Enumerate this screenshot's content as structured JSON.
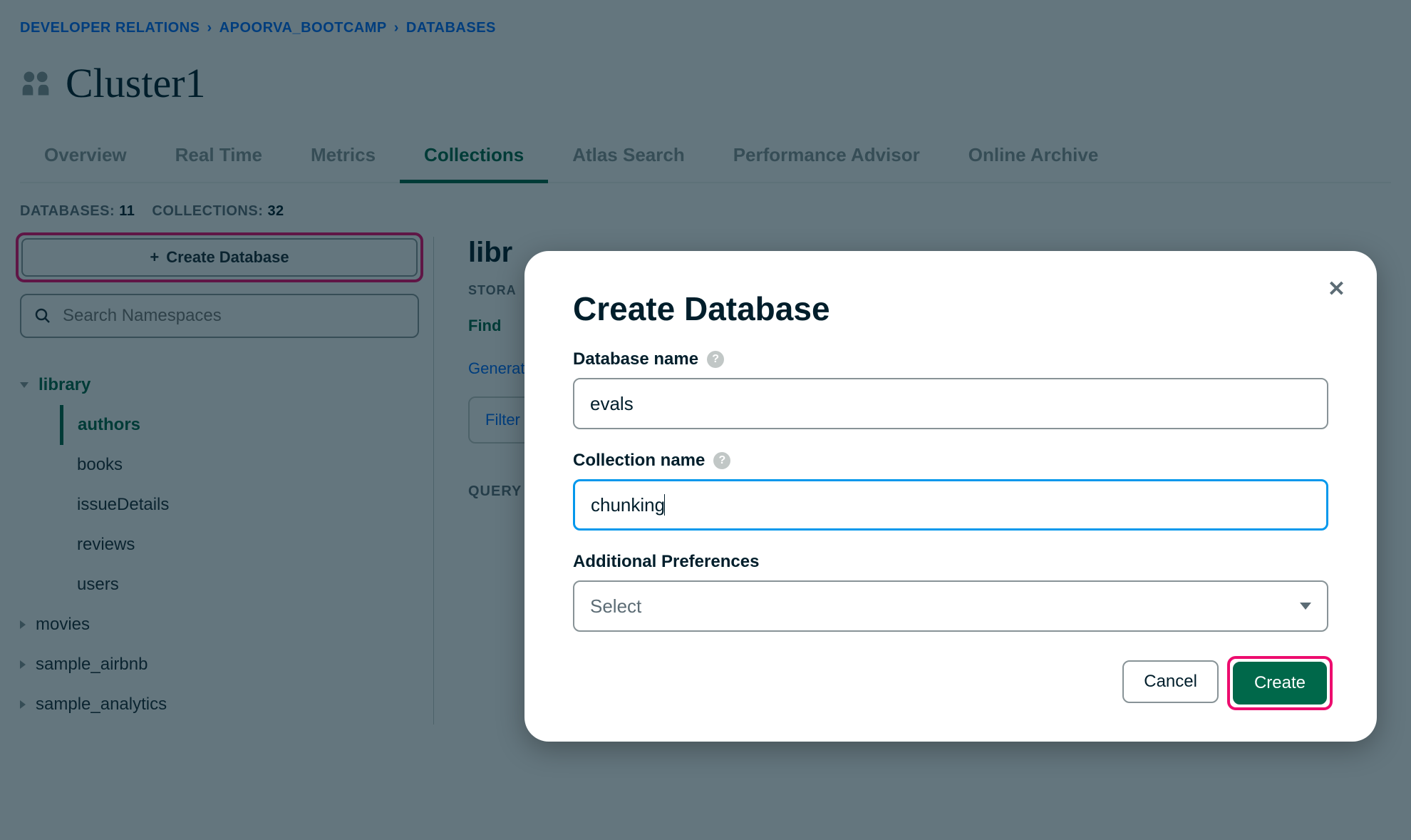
{
  "breadcrumb": [
    "DEVELOPER RELATIONS",
    "APOORVA_BOOTCAMP",
    "DATABASES"
  ],
  "cluster_name": "Cluster1",
  "tabs": [
    {
      "label": "Overview",
      "active": false
    },
    {
      "label": "Real Time",
      "active": false
    },
    {
      "label": "Metrics",
      "active": false
    },
    {
      "label": "Collections",
      "active": true
    },
    {
      "label": "Atlas Search",
      "active": false
    },
    {
      "label": "Performance Advisor",
      "active": false
    },
    {
      "label": "Online Archive",
      "active": false
    }
  ],
  "counts": {
    "db_label": "DATABASES:",
    "db_val": "11",
    "coll_label": "COLLECTIONS:",
    "coll_val": "32"
  },
  "create_db_label": "Create Database",
  "search_placeholder": "Search Namespaces",
  "databases": [
    {
      "name": "library",
      "expanded": true,
      "collections": [
        "authors",
        "books",
        "issueDetails",
        "reviews",
        "users"
      ],
      "active_collection": "authors"
    },
    {
      "name": "movies",
      "expanded": false
    },
    {
      "name": "sample_airbnb",
      "expanded": false
    },
    {
      "name": "sample_analytics",
      "expanded": false
    }
  ],
  "main": {
    "title_fragment": "libr",
    "storage_fragment": "STORA",
    "find": "Find",
    "generate_fragment": "Generate",
    "filter": "Filter",
    "query_fragment": "QUERY R"
  },
  "modal": {
    "title": "Create Database",
    "db_label": "Database name",
    "db_value": "evals",
    "coll_label": "Collection name",
    "coll_value": "chunking",
    "pref_label": "Additional Preferences",
    "pref_placeholder": "Select",
    "cancel": "Cancel",
    "create": "Create"
  }
}
